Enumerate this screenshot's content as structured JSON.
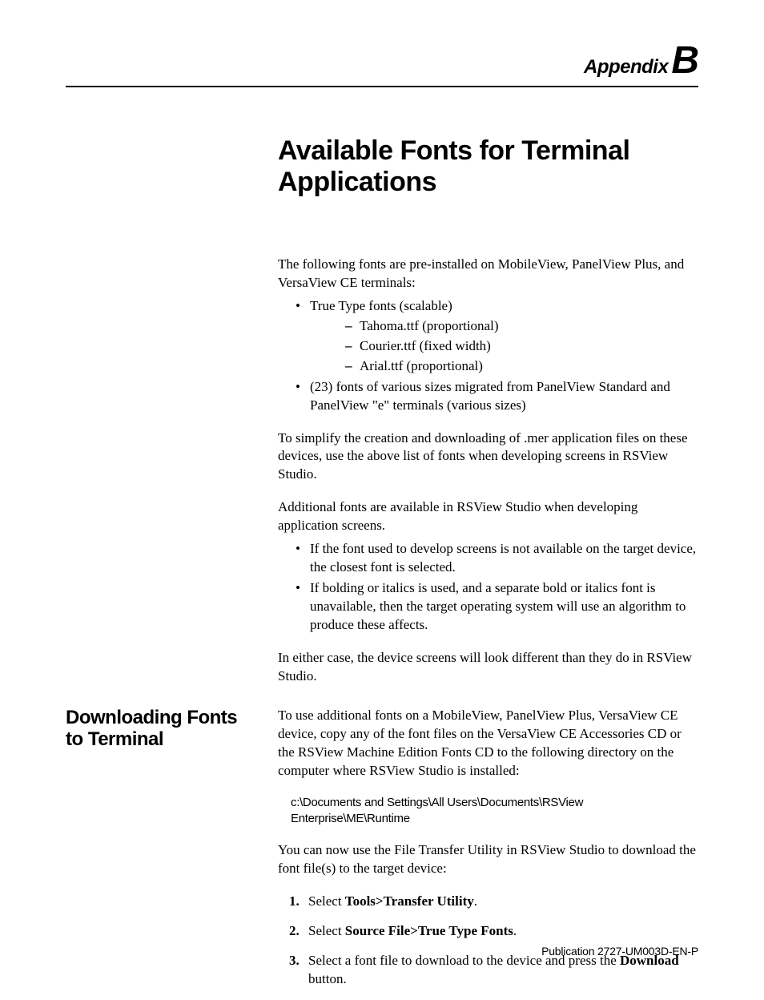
{
  "header": {
    "appendix_word": "Appendix",
    "appendix_letter": "B"
  },
  "title": "Available Fonts for Terminal Applications",
  "intro": "The following fonts are pre-installed on MobileView, PanelView Plus, and VersaView CE terminals:",
  "font_list": {
    "item1": "True Type fonts (scalable)",
    "sub1": "Tahoma.ttf (proportional)",
    "sub2": "Courier.ttf (fixed width)",
    "sub3": "Arial.ttf (proportional)",
    "item2": "(23) fonts of various sizes migrated from PanelView Standard and PanelView \"e\" terminals (various sizes)"
  },
  "para_simplify": "To simplify the creation and downloading of .mer application files on these devices, use the above list of fonts when developing screens in RSView Studio.",
  "para_additional": "Additional fonts are available in RSView Studio when developing application screens.",
  "caveats": {
    "c1": "If the font used to develop screens is not available on the target device, the closest font is selected.",
    "c2": "If bolding or italics is used, and a separate bold or italics font is unavailable, then the target operating system will use an algorithm to produce these affects."
  },
  "para_either": "In either case, the device screens will look different than they do in RSView Studio.",
  "section2": {
    "heading": "Downloading Fonts to Terminal",
    "p1": "To use additional fonts on a MobileView, PanelView Plus, VersaView CE device, copy any of the font files on the VersaView CE Accessories CD or the RSView Machine Edition Fonts CD to the following directory on the computer where RSView Studio is installed:",
    "path": "c:\\Documents and Settings\\All Users\\Documents\\RSView Enterprise\\ME\\Runtime",
    "p2": "You can now use the File Transfer Utility in RSView Studio to download the font file(s) to the target device:",
    "step1_a": "Select ",
    "step1_b": "Tools>Transfer Utility",
    "step1_c": ".",
    "step2_a": "Select ",
    "step2_b": "Source File>True Type Fonts",
    "step2_c": ".",
    "step3_a": "Select a font file to download to the device and press the ",
    "step3_b": "Download",
    "step3_c": " button."
  },
  "footer": "Publication 2727-UM003D-EN-P"
}
